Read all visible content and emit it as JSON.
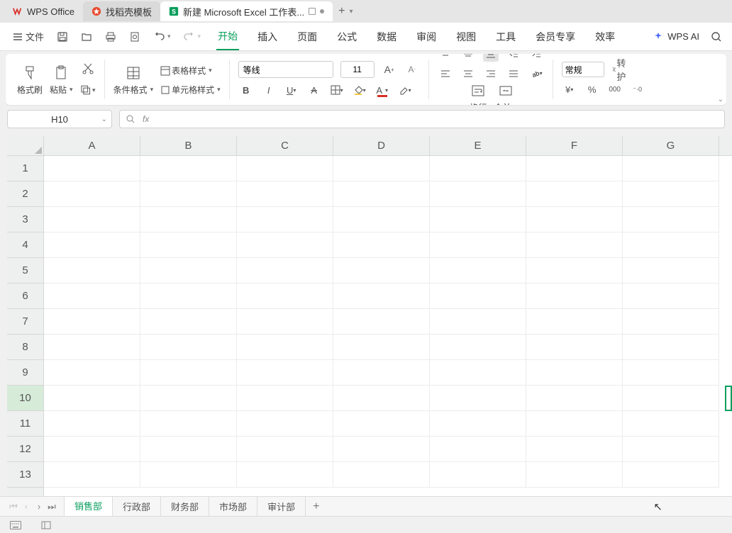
{
  "titlebar": {
    "app_name": "WPS Office",
    "template_tab": "找稻壳模板",
    "doc_tab": "新建 Microsoft Excel 工作表..."
  },
  "menubar": {
    "file": "文件",
    "tabs": [
      "开始",
      "插入",
      "页面",
      "公式",
      "数据",
      "审阅",
      "视图",
      "工具",
      "会员专享",
      "效率"
    ],
    "active_tab_index": 0,
    "ai": "WPS AI"
  },
  "ribbon": {
    "clipboard": {
      "format_painter": "格式刷",
      "paste": "粘贴"
    },
    "styles": {
      "table_style": "表格样式",
      "cond_format": "条件格式",
      "cell_style": "单元格样式"
    },
    "font": {
      "name": "等线",
      "size": "11",
      "bold": "B",
      "italic": "I"
    },
    "align": {
      "wrap": "换行",
      "merge": "合并"
    },
    "number": {
      "format": "常规",
      "transpose": "转护"
    }
  },
  "namebox": {
    "ref": "H10"
  },
  "grid": {
    "columns": [
      "A",
      "B",
      "C",
      "D",
      "E",
      "F",
      "G"
    ],
    "rows": [
      "1",
      "2",
      "3",
      "4",
      "5",
      "6",
      "7",
      "8",
      "9",
      "10",
      "11",
      "12",
      "13"
    ],
    "selected_row_index": 9
  },
  "sheets": {
    "tabs": [
      "销售部",
      "行政部",
      "财务部",
      "市场部",
      "审计部"
    ],
    "active_index": 0
  }
}
